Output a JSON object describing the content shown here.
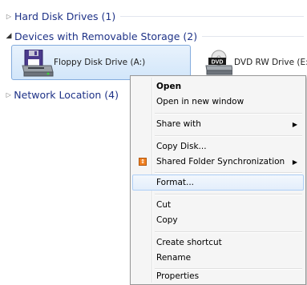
{
  "groups": {
    "hard_disk": "Hard Disk Drives (1)",
    "removable": "Devices with Removable Storage (2)",
    "network": "Network Location (4)"
  },
  "devices": {
    "floppy": {
      "label": "Floppy Disk Drive (A:)",
      "icon": "floppy-drive-icon"
    },
    "dvd": {
      "label": "DVD RW Drive (E:)",
      "icon": "dvd-drive-icon",
      "badge": "DVD"
    }
  },
  "menu": {
    "open": "Open",
    "open_new_window": "Open in new window",
    "share_with": "Share with",
    "copy_disk": "Copy Disk...",
    "shared_folder_sync": "Shared Folder Synchronization",
    "format": "Format...",
    "cut": "Cut",
    "copy": "Copy",
    "create_shortcut": "Create shortcut",
    "rename": "Rename",
    "properties": "Properties"
  },
  "colors": {
    "group_title": "#1e3287",
    "selection": "#d2e6fa",
    "menu_bg": "#f5f5f5"
  }
}
